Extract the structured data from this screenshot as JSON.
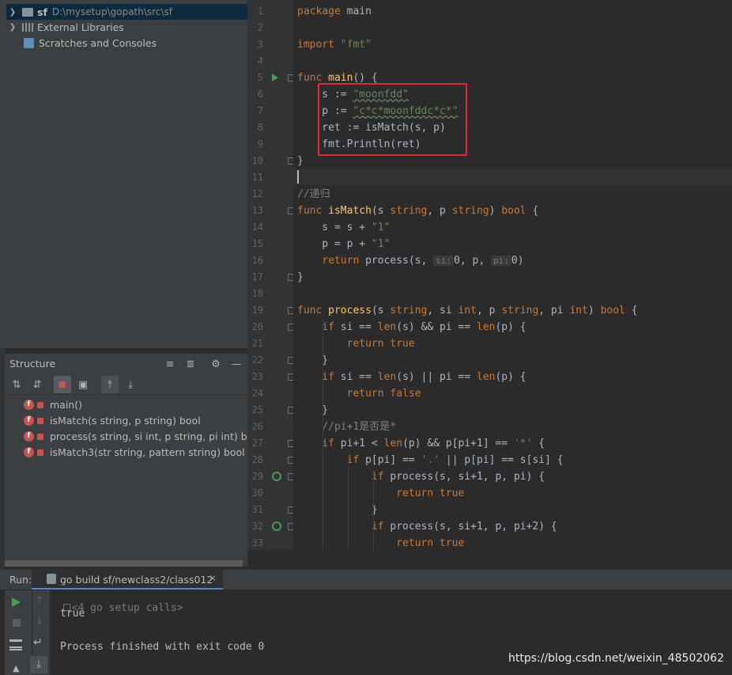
{
  "project_tree": {
    "root": {
      "name": "sf",
      "path": "D:\\mysetup\\gopath\\src\\sf"
    },
    "items": [
      "External Libraries",
      "Scratches and Consoles"
    ]
  },
  "structure": {
    "title": "Structure",
    "members": [
      "main()",
      "isMatch(s string, p string) bool",
      "process(s string, si int, p string, pi int) boo",
      "isMatch3(str string, pattern string) bool"
    ]
  },
  "editor": {
    "line_numbers": [
      "1",
      "2",
      "3",
      "4",
      "5",
      "6",
      "7",
      "8",
      "9",
      "10",
      "11",
      "12",
      "13",
      "14",
      "15",
      "16",
      "17",
      "18",
      "19",
      "20",
      "21",
      "22",
      "23",
      "24",
      "25",
      "26",
      "27",
      "28",
      "29",
      "30",
      "31",
      "32",
      "33"
    ],
    "code": {
      "l1_kw": "package",
      "l1_rest": " main",
      "l3_kw": "import",
      "l3_str": "\"fmt\"",
      "l5_kw": "func",
      "l5_fn": "main",
      "l5_rest": "() {",
      "l6_a": "    s := ",
      "l6_str": "\"moonfdd\"",
      "l7_a": "    p := ",
      "l7_str": "\"c*c*moonfddc*c*\"",
      "l8": "    ret := isMatch(s, p)",
      "l9": "    fmt.Println(ret)",
      "l10": "}",
      "l12": "//递归",
      "l13_kw": "func",
      "l13_fn": "isMatch",
      "l13_a": "(s ",
      "l13_k2": "string",
      "l13_b": ", p ",
      "l13_k3": "string",
      "l13_c": ") ",
      "l13_k4": "bool",
      "l13_d": " {",
      "l14_a": "    s = s + ",
      "l14_str": "\"1\"",
      "l15_a": "    p = p + ",
      "l15_str": "\"1\"",
      "l16_kw": "    return",
      "l16_a": " process(s, ",
      "l16_h1": "si:",
      "l16_b": "0, p, ",
      "l16_h2": "pi:",
      "l16_c": "0)",
      "l17": "}",
      "l19_kw": "func",
      "l19_fn": "process",
      "l19_a": "(s ",
      "l19_k2": "string",
      "l19_b": ", si ",
      "l19_k3": "int",
      "l19_c": ", p ",
      "l19_k4": "string",
      "l19_d": ", pi ",
      "l19_k5": "int",
      "l19_e": ") ",
      "l19_k6": "bool",
      "l19_f": " {",
      "l20_kw": "    if",
      "l20_a": " si == ",
      "l20_k2": "len",
      "l20_b": "(s) && pi == ",
      "l20_k3": "len",
      "l20_c": "(p) {",
      "l21_kw": "        return true",
      "l22": "    }",
      "l23_kw": "    if",
      "l23_a": " si == ",
      "l23_k2": "len",
      "l23_b": "(s) || pi == ",
      "l23_k3": "len",
      "l23_c": "(p) {",
      "l24_kw": "        return false",
      "l25": "    }",
      "l26": "    //pi+1是否是*",
      "l27_kw": "    if",
      "l27_a": " pi+1 < ",
      "l27_k2": "len",
      "l27_b": "(p) && p[pi+1] == ",
      "l27_str": "'*'",
      "l27_c": " {",
      "l28_kw": "        if",
      "l28_a": " p[pi] == ",
      "l28_str": "'.'",
      "l28_b": " || p[pi] == s[si] {",
      "l29_kw": "            if",
      "l29_a": " process(s, si+1, p, pi) {",
      "l30_kw": "                return true",
      "l31": "            }",
      "l32_kw": "            if",
      "l32_a": " process(s, si+1, p, pi+2) {",
      "l33_kw": "                return true"
    }
  },
  "run": {
    "label": "Run:",
    "tab": "go build sf/newclass2/class012",
    "setup": "<4 go setup calls>",
    "output": "true",
    "finished": "Process finished with exit code 0"
  },
  "watermark": "https://blog.csdn.net/weixin_48502062",
  "colors": {
    "highlight_box": "#e12b2b",
    "keyword": "#cc7832",
    "string": "#6a8759",
    "function": "#ffc66d"
  }
}
